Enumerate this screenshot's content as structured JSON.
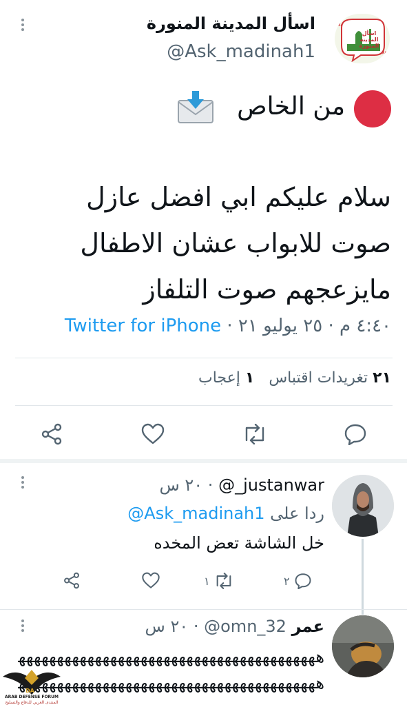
{
  "main_tweet": {
    "display_name": "اسأل المدينة المنورة",
    "handle": "@Ask_madinah1",
    "avatar_text": "اسأل المدينة المنورة",
    "header_line": "من الخاص",
    "body_lines": [
      "سلام عليكم ابي افضل عازل",
      "صوت للابواب عشان الاطفال",
      "مايزعجهم صوت التلفاز"
    ],
    "meta": {
      "time": "٤:٤٠ م · ٢٥ يوليو ٢١ ·",
      "source": "Twitter for iPhone"
    },
    "stats": {
      "quote_count": "٢١",
      "quote_label": "تغريدات اقتباس",
      "like_count": "١",
      "like_label": "إعجاب"
    }
  },
  "replies": [
    {
      "handle": "@_justanwar",
      "time": "٢٠ س",
      "replying_to_label": "ردا على",
      "replying_to_handle": "@Ask_madinah1",
      "text": "خل الشاشة تعض المخده",
      "reply_count": "٢",
      "retweet_count": "١"
    },
    {
      "display_name": "عمر",
      "handle": "@omn_32",
      "time": "٢٠ س",
      "text_line_1": "هههههههههههههههههههههههههههههههههههههههههههه",
      "text_line_2": "هههههههههههههههههههههههههههههههههههههههههههه"
    }
  ],
  "watermark": {
    "top": "DA",
    "line1": "ARAB DEFENSE FORUM",
    "line2": "المنتدى العربي للدفاع والتسليح"
  }
}
